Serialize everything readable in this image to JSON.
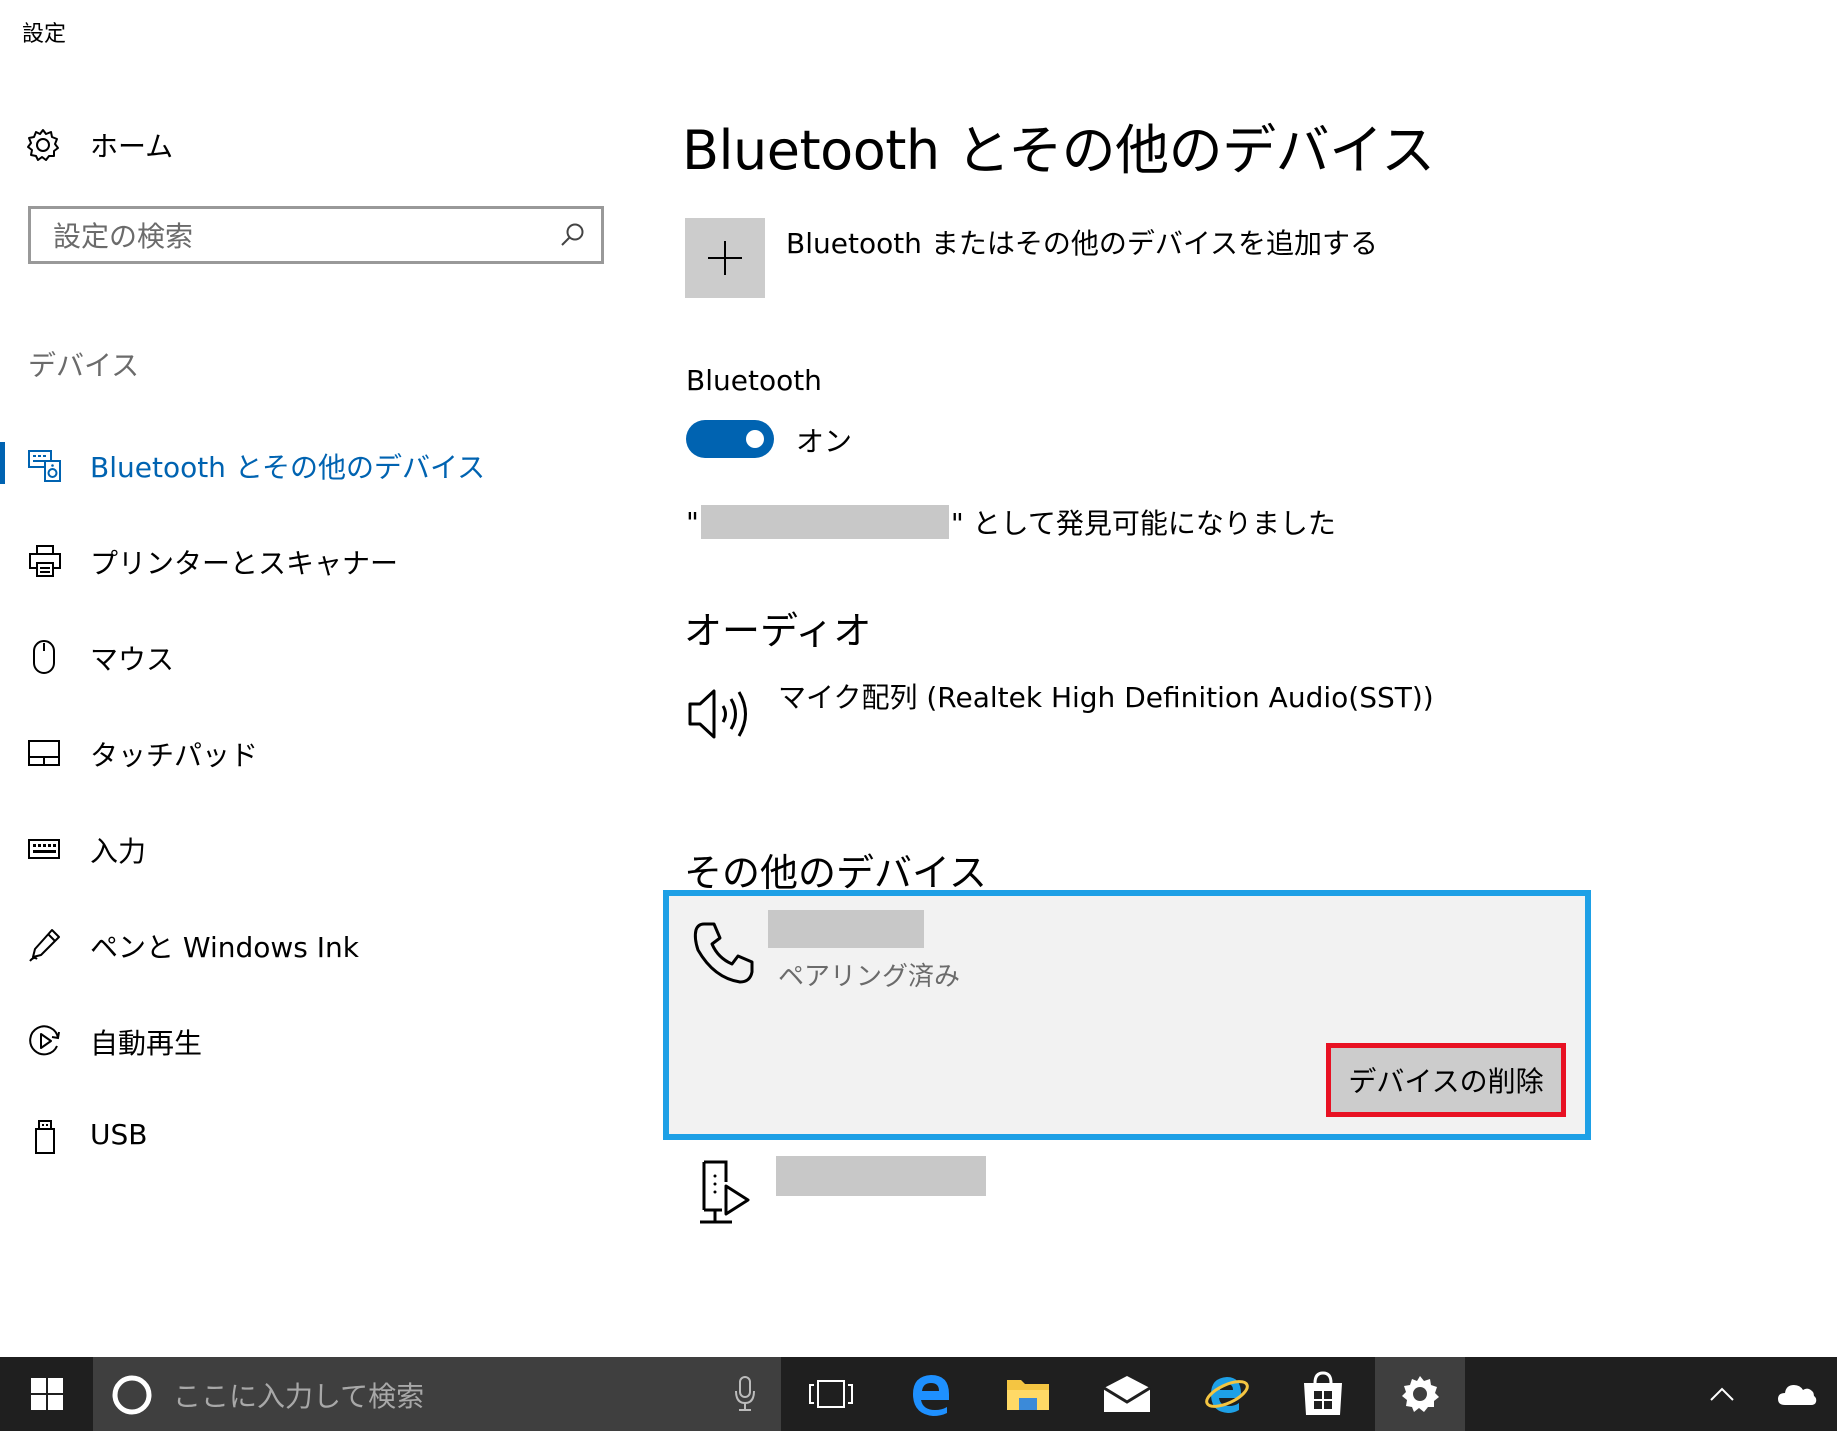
{
  "window": {
    "title": "設定"
  },
  "nav": {
    "home_label": "ホーム",
    "search_placeholder": "設定の検索",
    "group_label": "デバイス",
    "items": [
      {
        "label": "Bluetooth とその他のデバイス",
        "icon": "bluetooth-devices-icon",
        "active": true
      },
      {
        "label": "プリンターとスキャナー",
        "icon": "printer-icon"
      },
      {
        "label": "マウス",
        "icon": "mouse-icon"
      },
      {
        "label": "タッチパッド",
        "icon": "touchpad-icon"
      },
      {
        "label": "入力",
        "icon": "keyboard-icon"
      },
      {
        "label": "ペンと Windows Ink",
        "icon": "pen-icon"
      },
      {
        "label": "自動再生",
        "icon": "autoplay-icon"
      },
      {
        "label": "USB",
        "icon": "usb-icon"
      }
    ]
  },
  "main": {
    "title": "Bluetooth とその他のデバイス",
    "add_device_label": "Bluetooth またはその他のデバイスを追加する",
    "bluetooth_label": "Bluetooth",
    "toggle_state": "オン",
    "discoverable_open_quote": "\"",
    "discoverable_text": "\" として発見可能になりました",
    "audio_section": "オーディオ",
    "audio_device": "マイク配列 (Realtek High Definition Audio(SST))",
    "other_section": "その他のデバイス",
    "paired_status": "ペアリング済み",
    "remove_button": "デバイスの削除"
  },
  "taskbar": {
    "search_placeholder": "ここに入力して検索"
  },
  "colors": {
    "accent": "#0063b1",
    "card_border": "#1ea0e6",
    "remove_highlight": "#e81123",
    "taskbar": "#1f1f1f"
  }
}
